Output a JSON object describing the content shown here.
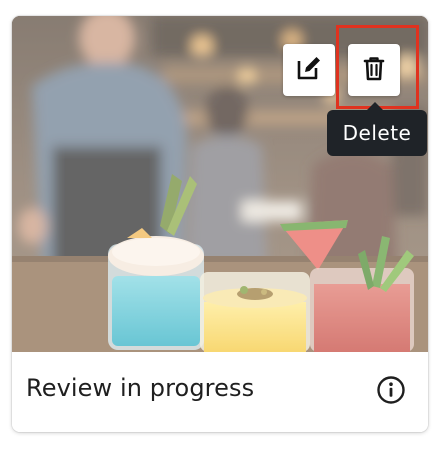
{
  "card": {
    "image_alt": "Cocktails on a bar counter",
    "status_text": "Review in progress"
  },
  "actions": {
    "edit_icon": "pencil-square-icon",
    "delete_icon": "trash-icon"
  },
  "tooltip": {
    "label": "Delete"
  },
  "colors": {
    "highlight": "#e0321f",
    "tooltip_bg": "#1f2328"
  }
}
